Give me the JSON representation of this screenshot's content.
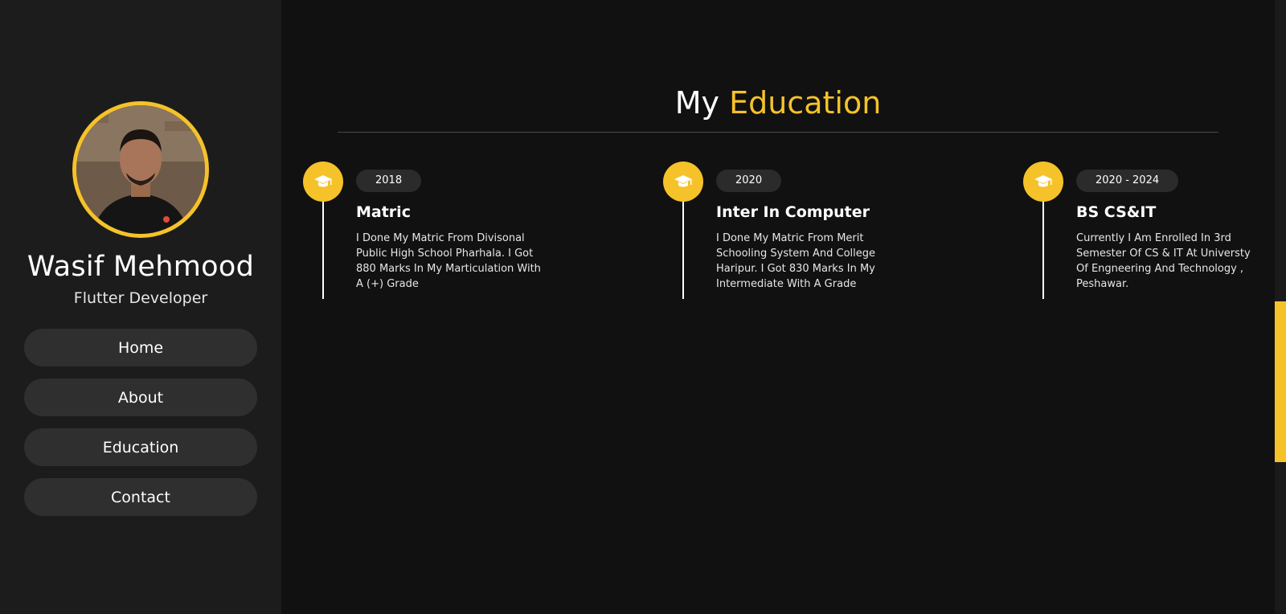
{
  "sidebar": {
    "name": "Wasif Mehmood",
    "role": "Flutter Developer",
    "nav": [
      {
        "label": "Home"
      },
      {
        "label": "About"
      },
      {
        "label": "Education"
      },
      {
        "label": "Contact"
      }
    ]
  },
  "main": {
    "title_prefix": "My",
    "title_accent": "Education",
    "education": [
      {
        "year": "2018",
        "title": "Matric",
        "description": "I Done My Matric From Divisonal Public High School Pharhala. I Got 880 Marks In My Marticulation With A (+) Grade",
        "icon": "graduation-cap-icon"
      },
      {
        "year": "2020",
        "title": "Inter In Computer",
        "description": "I Done My Matric From Merit Schooling System And College Haripur. I Got 830 Marks In My Intermediate With A Grade",
        "icon": "graduation-cap-icon"
      },
      {
        "year": "2020 - 2024",
        "title": "BS CS&IT",
        "description": "Currently I Am Enrolled In 3rd Semester Of CS & IT At Universty Of Engneering And Technology , Peshawar.",
        "icon": "graduation-cap-icon"
      }
    ]
  },
  "colors": {
    "accent": "#f5c229",
    "background": "#111111",
    "sidebar": "#1c1c1c",
    "button": "#2f2f2f"
  }
}
